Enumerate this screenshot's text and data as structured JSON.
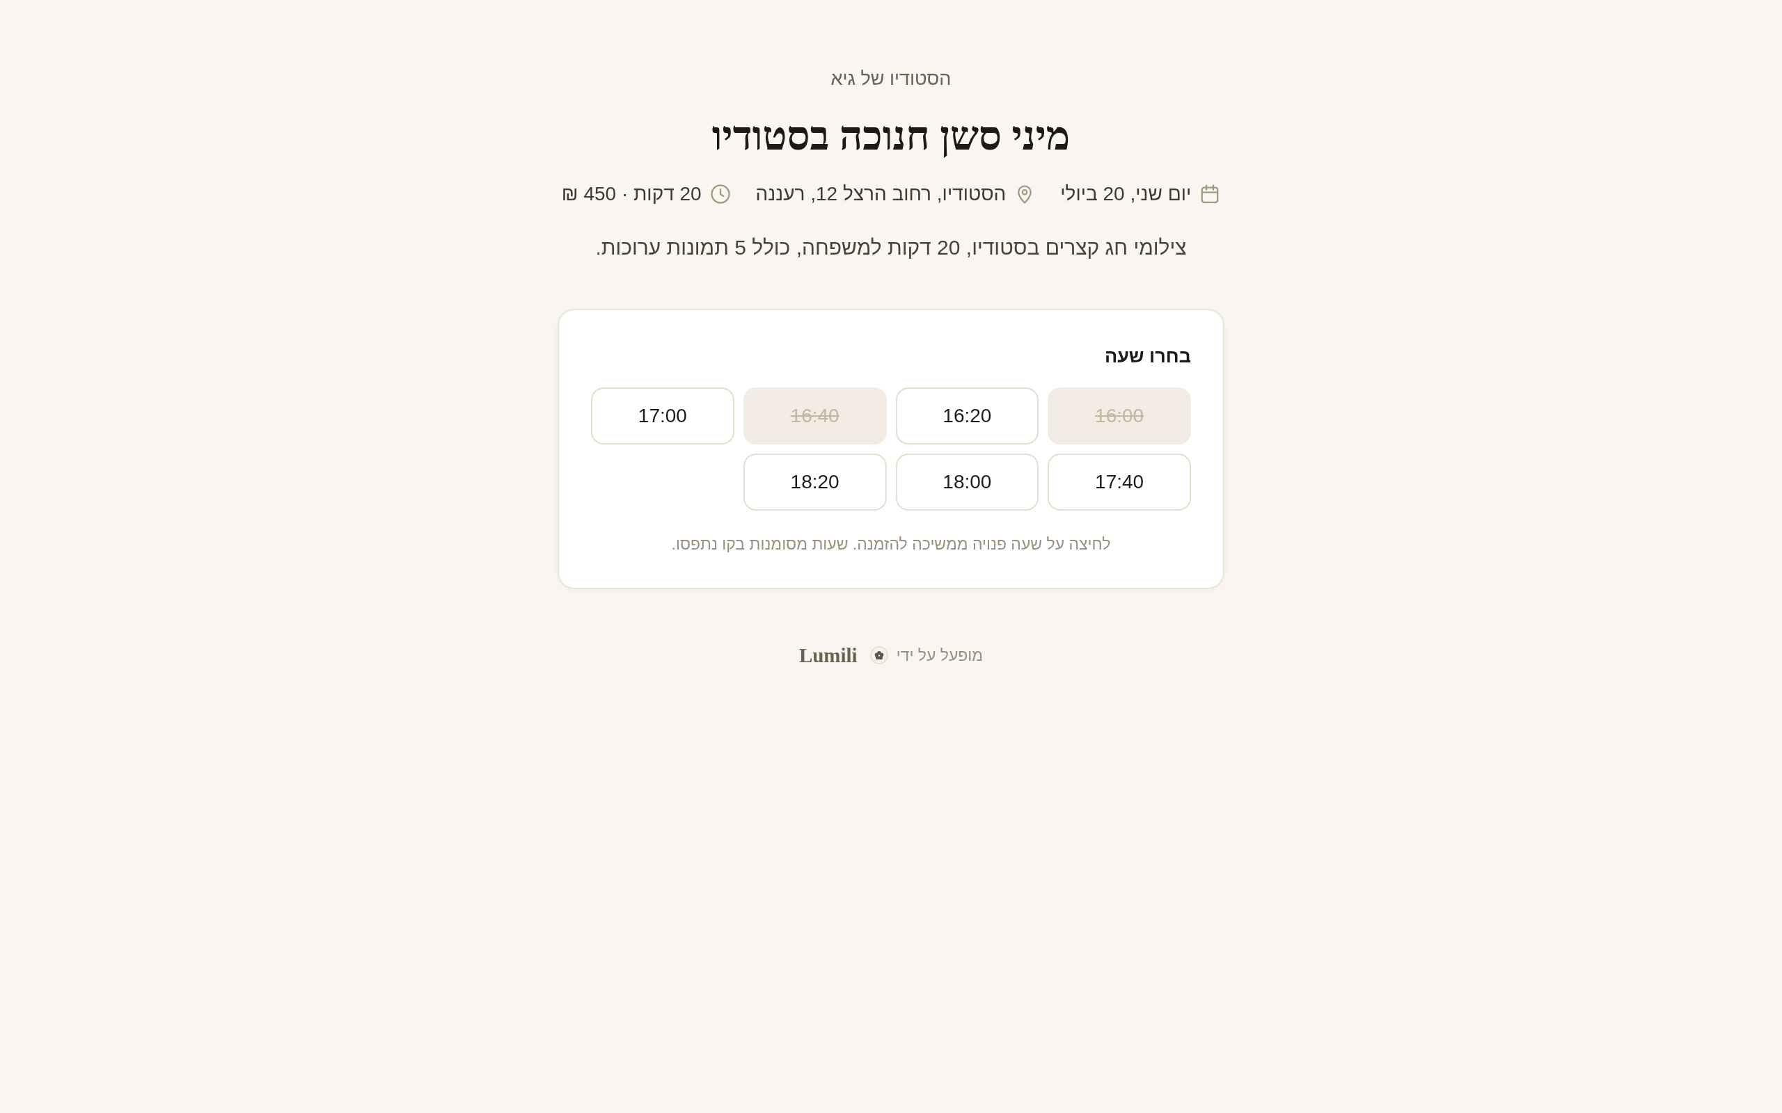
{
  "studio_name": "הסטודיו של גיא",
  "title": "מיני סשן חנוכה בסטודיו",
  "details": [
    {
      "kind": "date",
      "text": "יום שני, 20 ביולי"
    },
    {
      "kind": "location",
      "text": "הסטודיו, רחוב הרצל 12, רעננה"
    },
    {
      "kind": "duration",
      "text": "20 דקות · 450 ₪"
    }
  ],
  "description": "צילומי חג קצרים בסטודיו, 20 דקות למשפחה, כולל 5 תמונות ערוכות.",
  "time_picker": {
    "heading": "בחרו שעה",
    "slots": [
      {
        "time": "16:00",
        "disabled": true
      },
      {
        "time": "16:20",
        "disabled": false
      },
      {
        "time": "16:40",
        "disabled": true
      },
      {
        "time": "17:00",
        "disabled": false
      },
      {
        "time": "17:40",
        "disabled": false
      },
      {
        "time": "18:00",
        "disabled": false
      },
      {
        "time": "18:20",
        "disabled": false
      }
    ],
    "note": "לחיצה על שעה פנויה ממשיכה להזמנה. שעות מסומנות בקו נתפסו."
  },
  "footer": {
    "label": "מופעל על ידי",
    "brand": "Lumili"
  }
}
